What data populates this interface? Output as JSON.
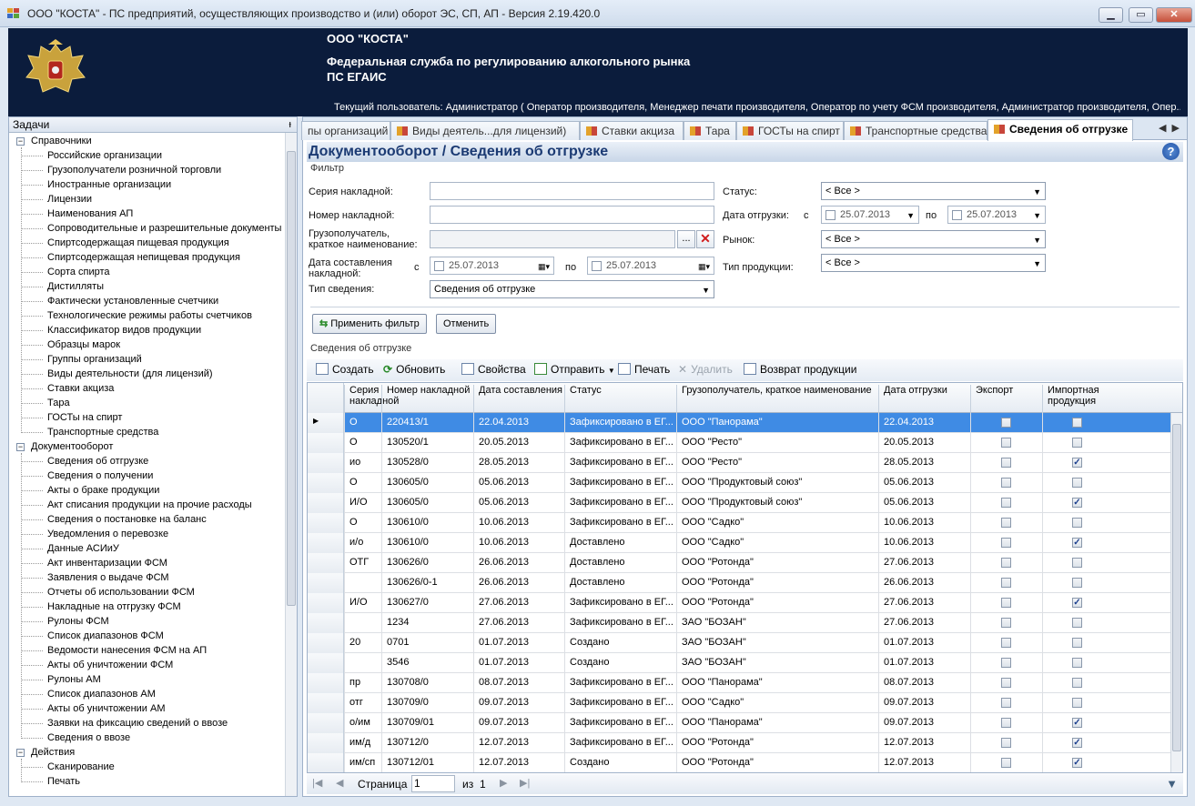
{
  "window": {
    "title": "ООО \"КОСТА\" - ПС предприятий, осуществляющих производство и (или) оборот ЭС, СП, АП - Версия 2.19.420.0"
  },
  "header": {
    "org": "ООО \"КОСТА\"",
    "agency_line1": "Федеральная служба по регулированию алкогольного рынка",
    "agency_line2": "ПС ЕГАИС",
    "user": "Текущий пользователь: Администратор ( Оператор производителя, Менеджер печати производителя, Оператор по учету ФСМ производителя, Администратор производителя, Опер..."
  },
  "sidebar": {
    "title": "Задачи",
    "pin": "ᵼ",
    "groups": [
      {
        "label": "Справочники",
        "items": [
          "Российские организации",
          "Грузополучатели розничной торговли",
          "Иностранные организации",
          "Лицензии",
          "Наименования АП",
          "Сопроводительные и разрешительные документы",
          "Спиртсодержащая пищевая продукция",
          "Спиртсодержащая непищевая продукция",
          "Сорта спирта",
          "Дистилляты",
          "Фактически установленные счетчики",
          "Технологические режимы работы счетчиков",
          "Классификатор видов продукции",
          "Образцы марок",
          "Группы организаций",
          "Виды деятельности (для лицензий)",
          "Ставки акциза",
          "Тара",
          "ГОСТы на спирт",
          "Транспортные средства"
        ]
      },
      {
        "label": "Документооборот",
        "items": [
          "Сведения об отгрузке",
          "Сведения о получении",
          "Акты о браке продукции",
          "Акт списания продукции на прочие расходы",
          "Сведения о постановке на баланс",
          "Уведомления о перевозке",
          "Данные АСИиУ",
          "Акт инвентаризации ФСМ",
          "Заявления о выдаче ФСМ",
          "Отчеты об использовании ФСМ",
          "Накладные на отгрузку ФСМ",
          "Рулоны ФСМ",
          "Список диапазонов ФСМ",
          "Ведомости нанесения ФСМ на АП",
          "Акты об уничтожении ФСМ",
          "Рулоны АМ",
          "Список диапазонов АМ",
          "Акты об уничтожении АМ",
          "Заявки на фиксацию сведений о ввозе",
          "Сведения о ввозе"
        ]
      },
      {
        "label": "Действия",
        "items": [
          "Сканирование",
          "Печать"
        ]
      }
    ]
  },
  "tabs": [
    {
      "label": "пы организаций"
    },
    {
      "label": "Виды деятель...для лицензий)"
    },
    {
      "label": "Ставки акциза"
    },
    {
      "label": "Тара"
    },
    {
      "label": "ГОСТы на спирт"
    },
    {
      "label": "Транспортные средства"
    },
    {
      "label": "Сведения об отгрузке",
      "active": true
    }
  ],
  "page": {
    "title": "Документооборот  / Сведения об отгрузке",
    "help": "?"
  },
  "filter": {
    "label": "Фильтр",
    "series_label": "Серия накладной:",
    "series_value": "",
    "number_label": "Номер накладной:",
    "number_value": "",
    "consignee_label": "Грузополучатель, краткое наименование:",
    "consignee_value": "",
    "browse": "...",
    "clear": "✕",
    "created_label": "Дата составления накладной:",
    "from": "с",
    "to": "по",
    "created_from": "25.07.2013",
    "created_to": "25.07.2013",
    "type_label": "Тип сведения:",
    "type_value": "Сведения об отгрузке",
    "status_label": "Статус:",
    "status_value": "< Все >",
    "ship_label": "Дата отгрузки:",
    "ship_from": "25.07.2013",
    "ship_to": "25.07.2013",
    "market_label": "Рынок:",
    "market_value": "< Все >",
    "ptype_label": "Тип продукции:",
    "ptype_value": "< Все >",
    "apply": "Применить фильтр",
    "cancel": "Отменить"
  },
  "grid": {
    "label": "Сведения об отгрузке",
    "toolbar": {
      "create": "Создать",
      "refresh": "Обновить",
      "props": "Свойства",
      "send": "Отправить",
      "print": "Печать",
      "delete": "Удалить",
      "return": "Возврат продукции"
    },
    "columns": [
      "Серия накладной",
      "Номер накладной",
      "Дата составления",
      "Статус",
      "Грузополучатель, краткое наименование",
      "Дата отгрузки",
      "Экспорт",
      "Импортная продукция"
    ],
    "rows": [
      {
        "series": "О",
        "number": "220413/1",
        "created": "22.04.2013",
        "status": "Зафиксировано в ЕГ...",
        "consignee": "ООО \"Панорама\"",
        "shipped": "22.04.2013",
        "export": false,
        "import": false
      },
      {
        "series": "О",
        "number": "130520/1",
        "created": "20.05.2013",
        "status": "Зафиксировано в ЕГ...",
        "consignee": "ООО \"Ресто\"",
        "shipped": "20.05.2013",
        "export": false,
        "import": false
      },
      {
        "series": "ио",
        "number": "130528/0",
        "created": "28.05.2013",
        "status": "Зафиксировано в ЕГ...",
        "consignee": "ООО \"Ресто\"",
        "shipped": "28.05.2013",
        "export": false,
        "import": true
      },
      {
        "series": "О",
        "number": "130605/0",
        "created": "05.06.2013",
        "status": "Зафиксировано в ЕГ...",
        "consignee": "ООО \"Продуктовый союз\"",
        "shipped": "05.06.2013",
        "export": false,
        "import": false
      },
      {
        "series": "И/О",
        "number": "130605/0",
        "created": "05.06.2013",
        "status": "Зафиксировано в ЕГ...",
        "consignee": "ООО \"Продуктовый союз\"",
        "shipped": "05.06.2013",
        "export": false,
        "import": true
      },
      {
        "series": "О",
        "number": "130610/0",
        "created": "10.06.2013",
        "status": "Зафиксировано в ЕГ...",
        "consignee": "ООО \"Садко\"",
        "shipped": "10.06.2013",
        "export": false,
        "import": false
      },
      {
        "series": "и/о",
        "number": "130610/0",
        "created": "10.06.2013",
        "status": "Доставлено",
        "consignee": "ООО \"Садко\"",
        "shipped": "10.06.2013",
        "export": false,
        "import": true
      },
      {
        "series": "ОТГ",
        "number": "130626/0",
        "created": "26.06.2013",
        "status": "Доставлено",
        "consignee": "ООО \"Ротонда\"",
        "shipped": "27.06.2013",
        "export": false,
        "import": false
      },
      {
        "series": "",
        "number": "130626/0-1",
        "created": "26.06.2013",
        "status": "Доставлено",
        "consignee": "ООО \"Ротонда\"",
        "shipped": "26.06.2013",
        "export": false,
        "import": false
      },
      {
        "series": "И/О",
        "number": "130627/0",
        "created": "27.06.2013",
        "status": "Зафиксировано в ЕГ...",
        "consignee": "ООО \"Ротонда\"",
        "shipped": "27.06.2013",
        "export": false,
        "import": true
      },
      {
        "series": "",
        "number": "1234",
        "created": "27.06.2013",
        "status": "Зафиксировано в ЕГ...",
        "consignee": "ЗАО \"БОЗАН\"",
        "shipped": "27.06.2013",
        "export": false,
        "import": false
      },
      {
        "series": "20",
        "number": "0701",
        "created": "01.07.2013",
        "status": "Создано",
        "consignee": "ЗАО \"БОЗАН\"",
        "shipped": "01.07.2013",
        "export": false,
        "import": false
      },
      {
        "series": "",
        "number": "3546",
        "created": "01.07.2013",
        "status": "Создано",
        "consignee": "ЗАО \"БОЗАН\"",
        "shipped": "01.07.2013",
        "export": false,
        "import": false
      },
      {
        "series": "пр",
        "number": "130708/0",
        "created": "08.07.2013",
        "status": "Зафиксировано в ЕГ...",
        "consignee": "ООО \"Панорама\"",
        "shipped": "08.07.2013",
        "export": false,
        "import": false
      },
      {
        "series": "отг",
        "number": "130709/0",
        "created": "09.07.2013",
        "status": "Зафиксировано в ЕГ...",
        "consignee": "ООО \"Садко\"",
        "shipped": "09.07.2013",
        "export": false,
        "import": false
      },
      {
        "series": "о/им",
        "number": "130709/01",
        "created": "09.07.2013",
        "status": "Зафиксировано в ЕГ...",
        "consignee": "ООО \"Панорама\"",
        "shipped": "09.07.2013",
        "export": false,
        "import": true
      },
      {
        "series": "им/д",
        "number": "130712/0",
        "created": "12.07.2013",
        "status": "Зафиксировано в ЕГ...",
        "consignee": "ООО \"Ротонда\"",
        "shipped": "12.07.2013",
        "export": false,
        "import": true
      },
      {
        "series": "им/сп",
        "number": "130712/01",
        "created": "12.07.2013",
        "status": "Создано",
        "consignee": "ООО \"Ротонда\"",
        "shipped": "12.07.2013",
        "export": false,
        "import": true
      }
    ]
  },
  "pager": {
    "page_label": "Страница",
    "page_value": "1",
    "of_label": "из",
    "total": "1"
  }
}
